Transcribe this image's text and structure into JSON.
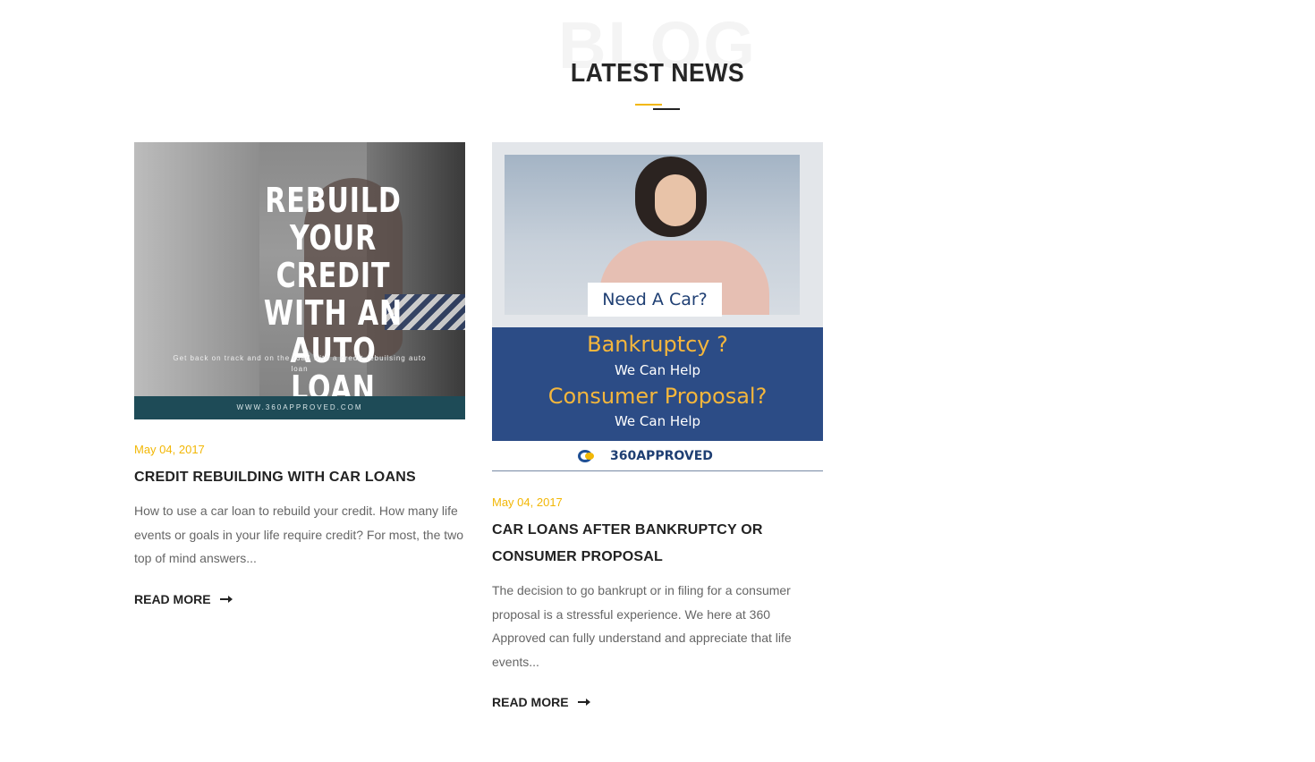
{
  "section": {
    "background_word": "BLOG",
    "title": "LATEST NEWS",
    "accent_color": "#f2b705"
  },
  "posts": [
    {
      "image": {
        "headline": "REBUILD YOUR CREDIT WITH AN AUTO LOAN",
        "subline": "Get back on track and on the road with a credit rebuilsing auto loan",
        "footer": "WWW.360APPROVED.COM"
      },
      "date": "May 04, 2017",
      "title": "CREDIT REBUILDING WITH CAR LOANS",
      "excerpt": "How to use a car loan to rebuild your credit. How many life events or goals in your life require credit? For most, the two top of mind answers...",
      "read_more": "READ MORE"
    },
    {
      "image": {
        "tag": "Need A Car?",
        "line1": "Bankruptcy ?",
        "line2": "We Can Help",
        "line3": "Consumer Proposal?",
        "line4": "We Can Help",
        "brand": "360APPROVED"
      },
      "date": "May 04, 2017",
      "title": "CAR LOANS AFTER BANKRUPTCY OR CONSUMER PROPOSAL",
      "excerpt": "The decision to go bankrupt or in filing for a consumer proposal is a stressful experience. We here at 360 Approved can fully understand and appreciate that life events...",
      "read_more": "READ MORE"
    }
  ]
}
